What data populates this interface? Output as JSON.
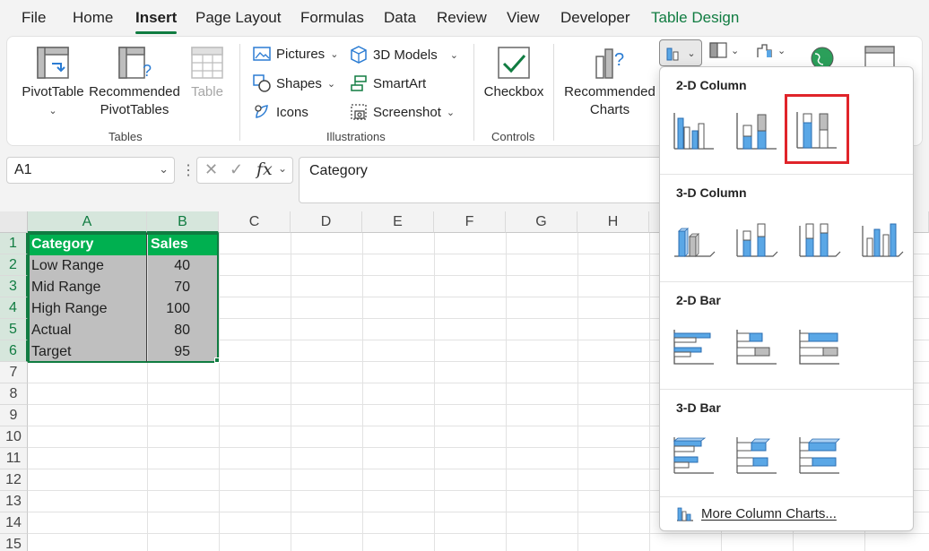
{
  "menu": {
    "tabs": [
      "File",
      "Home",
      "Insert",
      "Page Layout",
      "Formulas",
      "Data",
      "Review",
      "View",
      "Developer",
      "Table Design"
    ],
    "active": "Insert"
  },
  "ribbon": {
    "tables": {
      "label": "Tables",
      "pivot_table": "PivotTable",
      "recommended_pivot_line1": "Recommended",
      "recommended_pivot_line2": "PivotTables",
      "table": "Table"
    },
    "illustrations": {
      "label": "Illustrations",
      "pictures": "Pictures",
      "shapes": "Shapes",
      "icons": "Icons",
      "models_3d": "3D Models",
      "smartart": "SmartArt",
      "screenshot": "Screenshot"
    },
    "controls": {
      "label": "Controls",
      "checkbox": "Checkbox"
    },
    "charts": {
      "recommended_line1": "Recommended",
      "recommended_line2": "Charts"
    }
  },
  "formula_bar": {
    "name_box": "A1",
    "fx_symbol": "fx",
    "content": "Category"
  },
  "grid": {
    "columns": [
      "A",
      "B",
      "C",
      "D",
      "E",
      "F",
      "G",
      "H"
    ],
    "rows": [
      "1",
      "2",
      "3",
      "4",
      "5",
      "6",
      "7",
      "8",
      "9",
      "10",
      "11",
      "12",
      "13",
      "14",
      "15"
    ],
    "table": {
      "header": [
        "Category",
        "Sales"
      ],
      "rows": [
        [
          "Low Range",
          "40"
        ],
        [
          "Mid Range",
          "70"
        ],
        [
          "High Range",
          "100"
        ],
        [
          "Actual",
          "80"
        ],
        [
          "Target",
          "95"
        ]
      ]
    }
  },
  "dropdown": {
    "sections": [
      "2-D Column",
      "3-D Column",
      "2-D Bar",
      "3-D Bar"
    ],
    "more_link": "More Column Charts..."
  },
  "colors": {
    "accent_green": "#107c41",
    "table_header": "#00b050",
    "table_body": "#bfbfbf",
    "chart_blue": "#5aa7e6",
    "selection_red": "#e0242a"
  }
}
